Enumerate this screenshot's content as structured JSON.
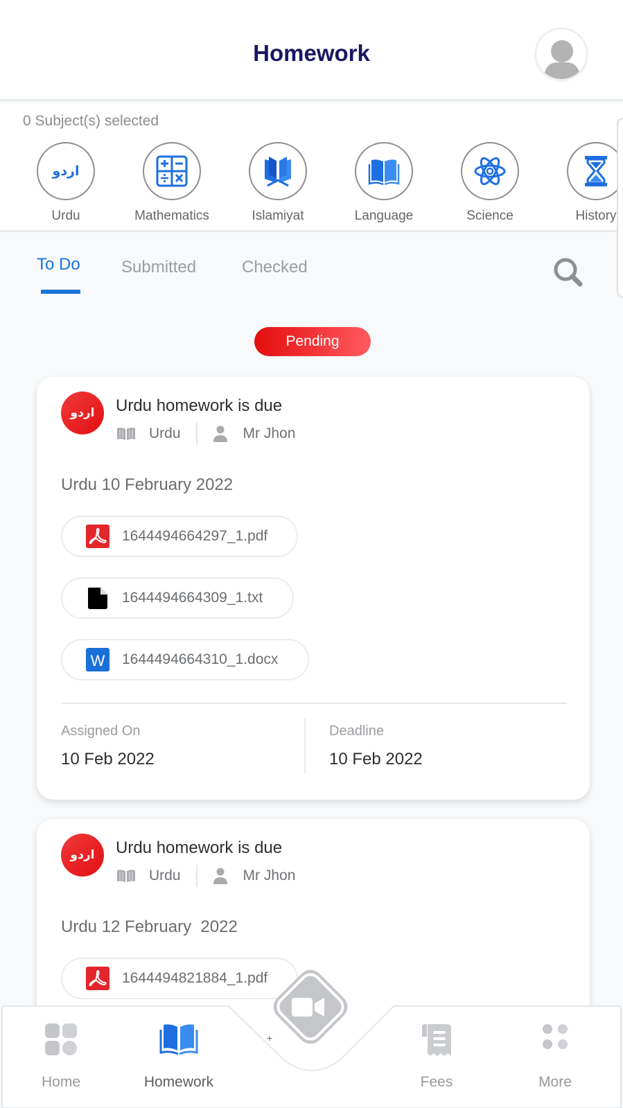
{
  "header": {
    "title": "Homework",
    "avatar_icon": "user-avatar-icon"
  },
  "subjects": {
    "selected_count_text": "0 Subject(s) selected",
    "items": [
      {
        "label": "Urdu",
        "icon": "urdu-script-icon",
        "glyph": "اردو"
      },
      {
        "label": "Mathematics",
        "icon": "calculator-icon"
      },
      {
        "label": "Islamiyat",
        "icon": "quran-book-icon"
      },
      {
        "label": "Language",
        "icon": "open-book-icon"
      },
      {
        "label": "Science",
        "icon": "atom-icon"
      },
      {
        "label": "History",
        "icon": "hourglass-icon"
      }
    ]
  },
  "tabs": {
    "items": [
      {
        "label": "To Do",
        "active": true
      },
      {
        "label": "Submitted",
        "active": false
      },
      {
        "label": "Checked",
        "active": false
      }
    ],
    "search_icon": "search-icon"
  },
  "status_filter": {
    "label": "Pending",
    "color": "#e40e0e"
  },
  "homework": [
    {
      "badge": "اردو",
      "title": "Urdu homework is due",
      "subject": "Urdu",
      "teacher": "Mr Jhon",
      "description": "Urdu 10 February 2022",
      "files": [
        {
          "name": "1644494664297_1.pdf",
          "type": "pdf"
        },
        {
          "name": "1644494664309_1.txt",
          "type": "txt"
        },
        {
          "name": "1644494664310_1.docx",
          "type": "docx"
        }
      ],
      "assigned_label": "Assigned On",
      "assigned_on": "10 Feb 2022",
      "deadline_label": "Deadline",
      "deadline": "10 Feb 2022"
    },
    {
      "badge": "اردو",
      "title": "Urdu homework is due",
      "subject": "Urdu",
      "teacher": "Mr Jhon",
      "description": "Urdu 12 February  2022",
      "files": [
        {
          "name": "1644494821884_1.pdf",
          "type": "pdf"
        }
      ]
    }
  ],
  "bottom_nav": {
    "items": [
      {
        "label": "Home",
        "icon": "home-grid-icon",
        "active": false
      },
      {
        "label": "Homework",
        "icon": "book-icon",
        "active": true
      },
      {
        "label": "Fees",
        "icon": "receipt-icon",
        "active": false
      },
      {
        "label": "More",
        "icon": "more-dots-icon",
        "active": false
      }
    ],
    "center_button_icon": "video-camera-icon",
    "center_button_glyph": "+"
  },
  "colors": {
    "accent": "#1a73d9",
    "title": "#1a1760",
    "pending": "#e40e0e",
    "icon_blue": "#1e6fe0"
  }
}
